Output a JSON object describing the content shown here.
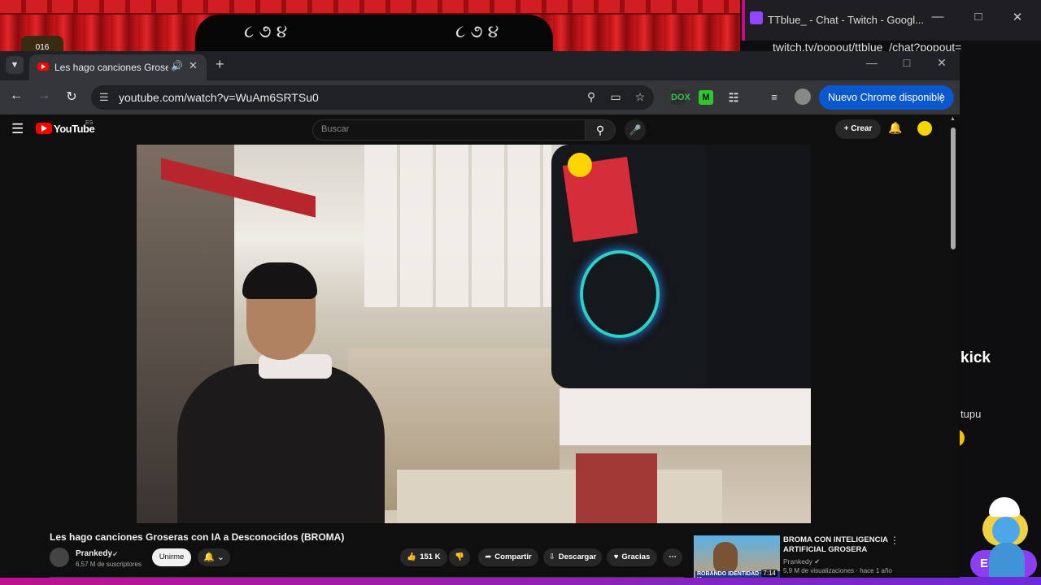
{
  "overlay": {
    "badge_text": "016",
    "swirl": "૮ ૭ ૪"
  },
  "twitch_window": {
    "title": "TTblue_ - Chat - Twitch - Googl...",
    "url": "twitch.tv/popout/ttblue_/chat?popout=",
    "kick_text": "kick",
    "chat_text": "tupu",
    "button_label": "E"
  },
  "chrome": {
    "tab_title": "Les hago canciones Groseras",
    "url": "youtube.com/watch?v=WuAm6SRTSu0",
    "update_button": "Nuevo Chrome disponible",
    "extensions": [
      {
        "name": "dfx-extension",
        "label": "DOX",
        "color": "#36c24b"
      },
      {
        "name": "m-extension",
        "label": "M",
        "color": "#2ec52e"
      }
    ]
  },
  "youtube": {
    "logo_text": "YouTube",
    "logo_country": "ES",
    "search_placeholder": "Buscar",
    "create_label": "Crear"
  },
  "video": {
    "title": "Les hago canciones Groseras con IA a Desconocidos (BROMA)",
    "channel": "Prankedy",
    "subscribers": "6,57 M de suscriptores",
    "join_label": "Unirme",
    "likes": "151 K",
    "share_label": "Compartir",
    "download_label": "Descargar",
    "thanks_label": "Gracias"
  },
  "recommended": {
    "title": "BROMA CON INTELIGENCIA ARTIFICIAL GROSERA",
    "channel": "Prankedy",
    "meta": "5,9 M de visualizaciones · hace 1 año",
    "duration": "7:14",
    "thumb_text": "ROBANDO IDENTIDAD CON IA"
  }
}
